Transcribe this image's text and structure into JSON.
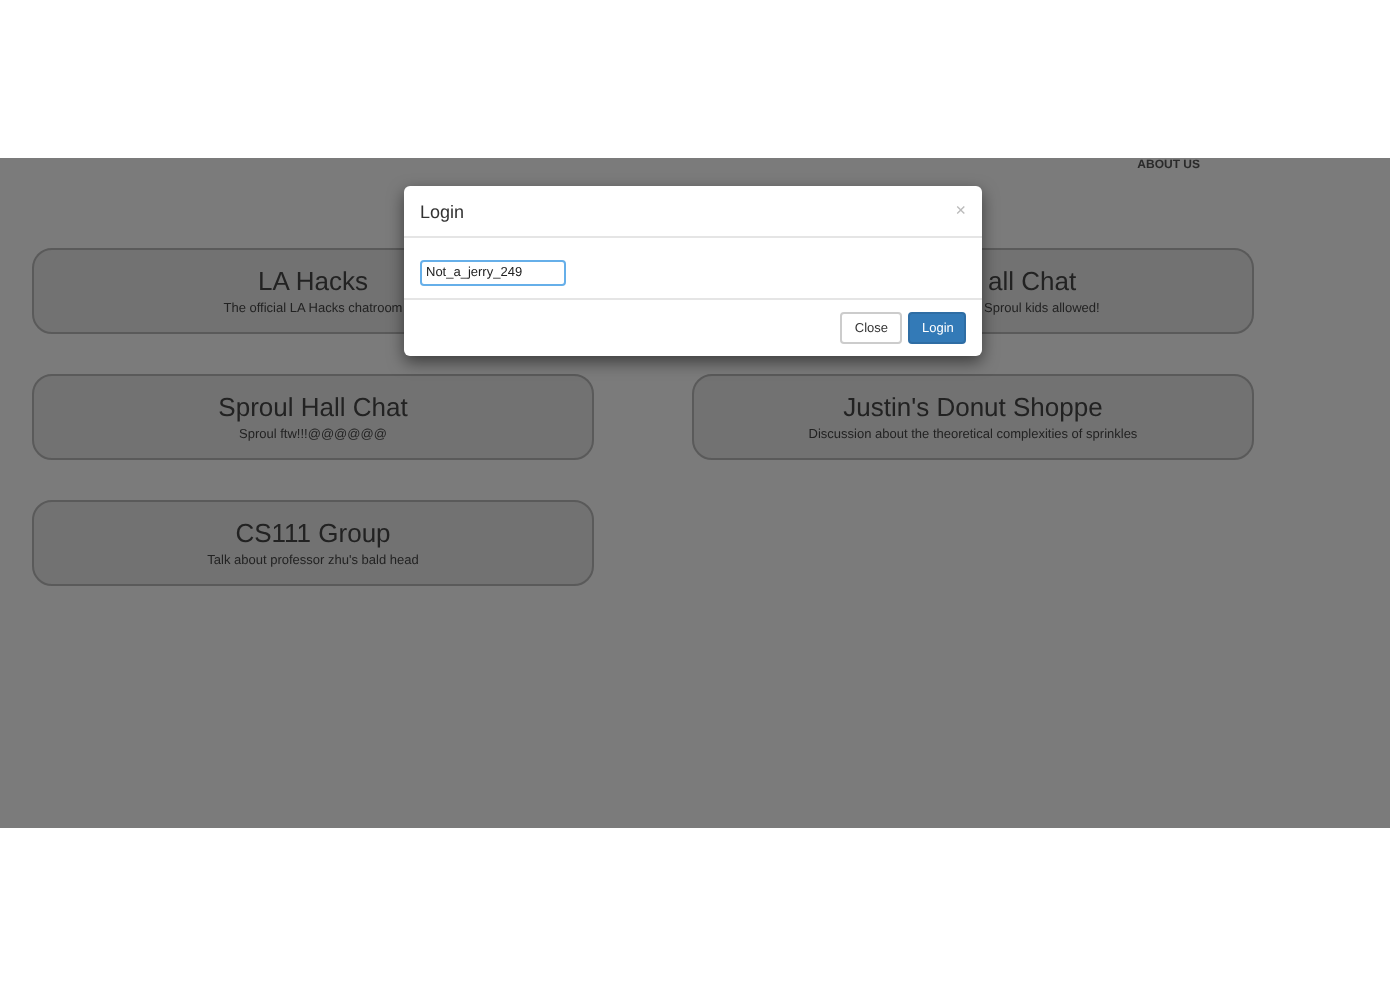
{
  "nav": {
    "link": "ABOUT US"
  },
  "rooms": [
    {
      "kind": "full",
      "name": "LA Hacks",
      "description": "The official LA Hacks chatroom"
    },
    {
      "kind": "partly_hidden",
      "name": "all Chat",
      "description": "Sproul kids allowed!"
    },
    {
      "kind": "full",
      "name": "Sproul Hall Chat",
      "description": "Sproul ftw!!!@@@@@@"
    },
    {
      "kind": "full",
      "name": "Justin's Donut Shoppe",
      "description": "Discussion about the theoretical complexities of sprinkles"
    },
    {
      "kind": "full",
      "name": "CS111 Group",
      "description": "Talk about professor zhu's bald head"
    }
  ],
  "modal": {
    "title": "Login",
    "close_icon": "×",
    "username": "Not_a_jerry_249",
    "buttons": [
      {
        "label": "Close",
        "kind": "default"
      },
      {
        "label": "Login",
        "kind": "primary"
      }
    ]
  }
}
